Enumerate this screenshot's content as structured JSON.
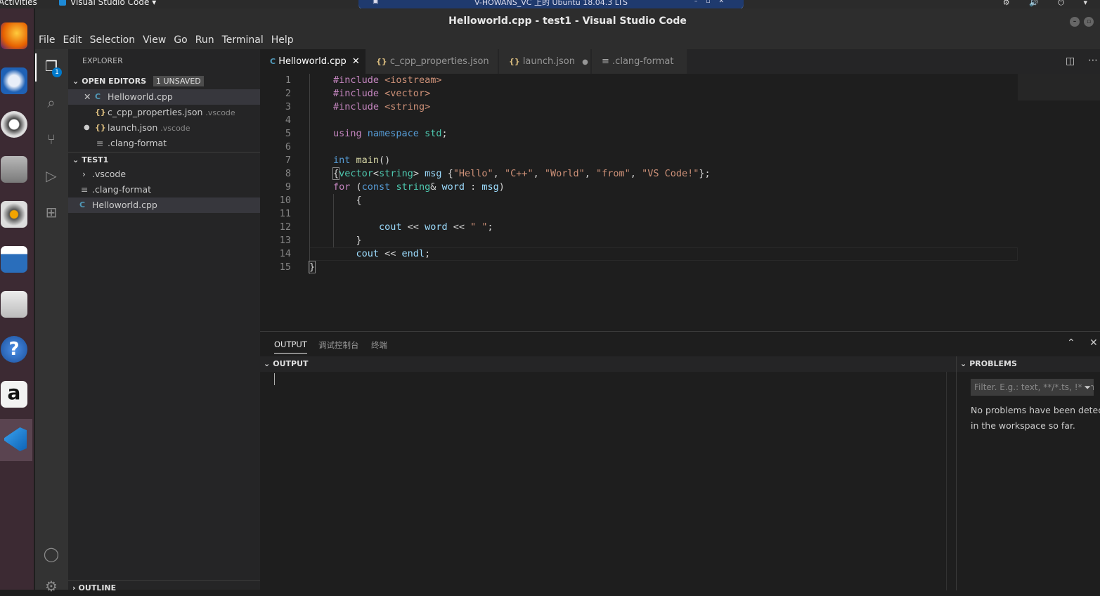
{
  "system": {
    "activities": "Activities",
    "app_name": "Visual Studio Code",
    "vm_title": "V-HOWANS_VC 上的 Ubuntu 18.04.3 LTS"
  },
  "window": {
    "title": "Helloworld.cpp - test1 - Visual Studio Code"
  },
  "menu": [
    "File",
    "Edit",
    "Selection",
    "View",
    "Go",
    "Run",
    "Terminal",
    "Help"
  ],
  "activity_bar": {
    "explorer_badge": "1"
  },
  "explorer": {
    "title": "EXPLORER",
    "open_editors": {
      "label": "OPEN EDITORS",
      "badge": "1 UNSAVED",
      "items": [
        {
          "name": "Helloworld.cpp",
          "dir": ""
        },
        {
          "name": "c_cpp_properties.json",
          "dir": ".vscode"
        },
        {
          "name": "launch.json",
          "dir": ".vscode"
        },
        {
          "name": ".clang-format",
          "dir": ""
        }
      ]
    },
    "folder": {
      "label": "TEST1",
      "items": [
        ".vscode",
        ".clang-format",
        "Helloworld.cpp"
      ]
    },
    "outline": "OUTLINE"
  },
  "tabs": [
    "Helloworld.cpp",
    "c_cpp_properties.json",
    "launch.json",
    ".clang-format"
  ],
  "editor": {
    "line_numbers": [
      "1",
      "2",
      "3",
      "4",
      "5",
      "6",
      "7",
      "8",
      "9",
      "10",
      "11",
      "12",
      "13",
      "14",
      "15"
    ]
  },
  "panel": {
    "tabs": [
      "OUTPUT",
      "调试控制台",
      "终端"
    ],
    "output_header": "OUTPUT",
    "problems_header": "PROBLEMS",
    "filter_placeholder": "Filter. E.g.: text, **/*.ts, !**/node_modules/**",
    "no_problems_line1": "No problems have been detected",
    "no_problems_line2": "in the workspace so far."
  },
  "colors": {
    "accent": "#007acc",
    "dock": "#3c2a33",
    "editor_bg": "#1e1e1e"
  },
  "icons": {
    "dock": [
      "firefox-icon",
      "thunderbird-icon",
      "software-updater-icon",
      "files-icon",
      "rhythmbox-icon",
      "writer-icon",
      "software-center-icon",
      "help-icon",
      "amazon-icon",
      "vscode-icon"
    ]
  }
}
